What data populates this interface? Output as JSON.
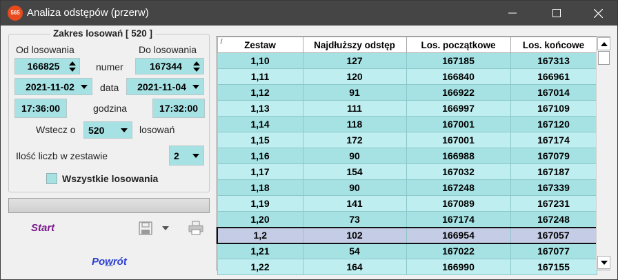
{
  "window": {
    "title": "Analiza odstępów (przerw)",
    "app_icon_text": "565"
  },
  "range": {
    "group_title": "Zakres losowań  [ 520 ]",
    "from_label": "Od losowania",
    "to_label": "Do losowania",
    "numer_label": "numer",
    "data_label": "data",
    "godzina_label": "godzina",
    "from_number": "166825",
    "to_number": "167344",
    "from_date": "2021-11-02",
    "to_date": "2021-11-04",
    "from_time": "17:36:00",
    "to_time": "17:32:00",
    "back_label": "Wstecz o",
    "back_value": "520",
    "back_suffix": "losowań",
    "set_size_label": "Ilość liczb w zestawie",
    "set_size_value": "2",
    "all_draws_label": "Wszystkie losowania"
  },
  "actions": {
    "start_label": "Start",
    "back_pre": "Po",
    "back_ul": "w",
    "back_post": "rót"
  },
  "grid": {
    "sort_mark": "/",
    "headers": [
      "Zestaw",
      "Najdłuższy odstęp",
      "Los. początkowe",
      "Los. końcowe"
    ],
    "rows": [
      [
        "1,10",
        "127",
        "167185",
        "167313"
      ],
      [
        "1,11",
        "120",
        "166840",
        "166961"
      ],
      [
        "1,12",
        "91",
        "166922",
        "167014"
      ],
      [
        "1,13",
        "111",
        "166997",
        "167109"
      ],
      [
        "1,14",
        "118",
        "167001",
        "167120"
      ],
      [
        "1,15",
        "172",
        "167001",
        "167174"
      ],
      [
        "1,16",
        "90",
        "166988",
        "167079"
      ],
      [
        "1,17",
        "154",
        "167032",
        "167187"
      ],
      [
        "1,18",
        "90",
        "167248",
        "167339"
      ],
      [
        "1,19",
        "141",
        "167089",
        "167231"
      ],
      [
        "1,20",
        "73",
        "167174",
        "167248"
      ],
      [
        "1,2",
        "102",
        "166954",
        "167057"
      ],
      [
        "1,21",
        "54",
        "167022",
        "167077"
      ],
      [
        "1,22",
        "164",
        "166990",
        "167155"
      ]
    ],
    "selected_row": 11
  },
  "colors": {
    "field_bg": "#a6e2e4",
    "row_light": "#bfeef0",
    "selected_bg": "#c5cde6",
    "start_color": "#7a1a8c",
    "back_color": "#2b3ed0"
  }
}
